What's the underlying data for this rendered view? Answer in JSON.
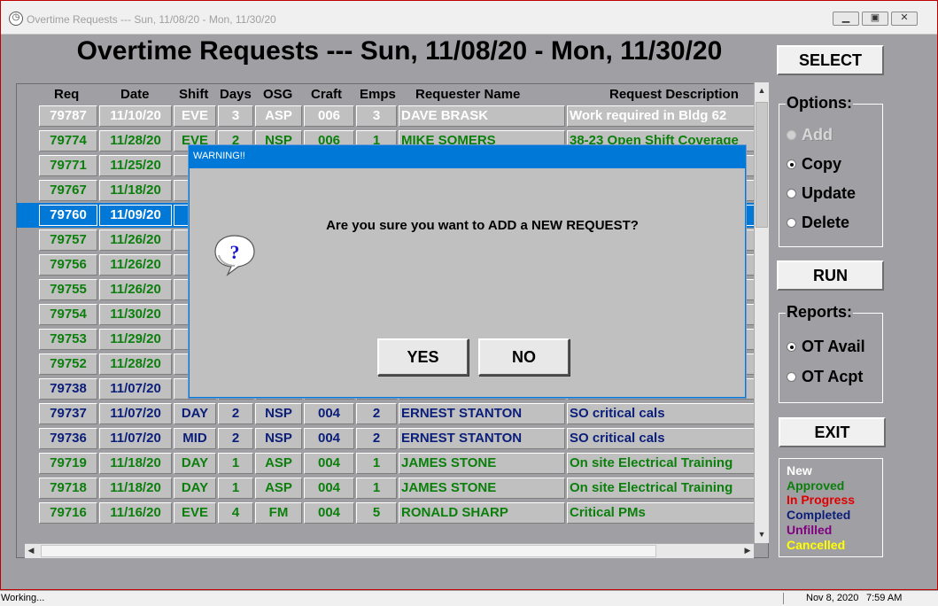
{
  "window": {
    "title": "Overtime Requests --- Sun, 11/08/20 - Mon, 11/30/20",
    "controls": [
      "minimize",
      "restore",
      "close"
    ]
  },
  "main": {
    "title": "Overtime Requests --- Sun, 11/08/20 - Mon, 11/30/20",
    "columns": [
      "Req",
      "Date",
      "Shift",
      "Days",
      "OSG",
      "Craft",
      "Emps",
      "Requester Name",
      "Request Description"
    ],
    "rows": [
      {
        "req": "79787",
        "date": "11/10/20",
        "shift": "EVE",
        "days": "3",
        "osg": "ASP",
        "craft": "006",
        "emps": "3",
        "name": "DAVE BRASK",
        "desc": "Work required in Bldg 62",
        "status": "new"
      },
      {
        "req": "79774",
        "date": "11/28/20",
        "shift": "EVE",
        "days": "2",
        "osg": "NSP",
        "craft": "006",
        "emps": "1",
        "name": "MIKE SOMERS",
        "desc": "38-23 Open Shift Coverage",
        "status": "approved"
      },
      {
        "req": "79771",
        "date": "11/25/20",
        "shift": "E",
        "days": "",
        "osg": "",
        "craft": "",
        "emps": "",
        "name": "",
        "desc": "e",
        "status": "approved"
      },
      {
        "req": "79767",
        "date": "11/18/20",
        "shift": "E",
        "days": "",
        "osg": "",
        "craft": "",
        "emps": "",
        "name": "",
        "desc": "e",
        "status": "approved"
      },
      {
        "req": "79760",
        "date": "11/09/20",
        "shift": "D",
        "days": "",
        "osg": "",
        "craft": "",
        "emps": "",
        "name": "",
        "desc": "",
        "status": "selected"
      },
      {
        "req": "79757",
        "date": "11/26/20",
        "shift": "E",
        "days": "",
        "osg": "",
        "craft": "",
        "emps": "",
        "name": "",
        "desc": "",
        "status": "approved"
      },
      {
        "req": "79756",
        "date": "11/26/20",
        "shift": "D",
        "days": "",
        "osg": "",
        "craft": "",
        "emps": "",
        "name": "",
        "desc": "",
        "status": "approved"
      },
      {
        "req": "79755",
        "date": "11/26/20",
        "shift": "M",
        "days": "",
        "osg": "",
        "craft": "",
        "emps": "",
        "name": "",
        "desc": "",
        "status": "approved"
      },
      {
        "req": "79754",
        "date": "11/30/20",
        "shift": "E",
        "days": "",
        "osg": "",
        "craft": "",
        "emps": "",
        "name": "",
        "desc": "O",
        "status": "approved"
      },
      {
        "req": "79753",
        "date": "11/29/20",
        "shift": "D",
        "days": "",
        "osg": "",
        "craft": "",
        "emps": "",
        "name": "",
        "desc": "O",
        "status": "approved"
      },
      {
        "req": "79752",
        "date": "11/28/20",
        "shift": "M",
        "days": "",
        "osg": "",
        "craft": "",
        "emps": "",
        "name": "",
        "desc": "v",
        "status": "approved"
      },
      {
        "req": "79738",
        "date": "11/07/20",
        "shift": "E",
        "days": "",
        "osg": "",
        "craft": "",
        "emps": "",
        "name": "",
        "desc": "",
        "status": "completed"
      },
      {
        "req": "79737",
        "date": "11/07/20",
        "shift": "DAY",
        "days": "2",
        "osg": "NSP",
        "craft": "004",
        "emps": "2",
        "name": "ERNEST STANTON",
        "desc": "SO critical cals",
        "status": "completed"
      },
      {
        "req": "79736",
        "date": "11/07/20",
        "shift": "MID",
        "days": "2",
        "osg": "NSP",
        "craft": "004",
        "emps": "2",
        "name": "ERNEST STANTON",
        "desc": "SO critical cals",
        "status": "completed"
      },
      {
        "req": "79719",
        "date": "11/18/20",
        "shift": "DAY",
        "days": "1",
        "osg": "ASP",
        "craft": "004",
        "emps": "1",
        "name": "JAMES STONE",
        "desc": "On site Electrical Training",
        "status": "approved"
      },
      {
        "req": "79718",
        "date": "11/18/20",
        "shift": "DAY",
        "days": "1",
        "osg": "ASP",
        "craft": "004",
        "emps": "1",
        "name": "JAMES STONE",
        "desc": "On site Electrical Training",
        "status": "approved"
      },
      {
        "req": "79716",
        "date": "11/16/20",
        "shift": "EVE",
        "days": "4",
        "osg": "FM",
        "craft": "004",
        "emps": "5",
        "name": "RONALD SHARP",
        "desc": "Critical PMs",
        "status": "approved"
      }
    ]
  },
  "panel": {
    "select_label": "SELECT",
    "options_label": "Options:",
    "options": [
      {
        "label": "Add",
        "checked": false,
        "disabled": true
      },
      {
        "label": "Copy",
        "checked": true,
        "disabled": false
      },
      {
        "label": "Update",
        "checked": false,
        "disabled": false
      },
      {
        "label": "Delete",
        "checked": false,
        "disabled": false
      }
    ],
    "run_label": "RUN",
    "reports_label": "Reports:",
    "reports": [
      {
        "label": "OT Avail",
        "checked": true
      },
      {
        "label": "OT Acpt",
        "checked": false
      }
    ],
    "exit_label": "EXIT"
  },
  "legend": [
    {
      "label": "New",
      "color": "#ffffff"
    },
    {
      "label": "Approved",
      "color": "#0b7f0b"
    },
    {
      "label": "In Progress",
      "color": "#e00000"
    },
    {
      "label": "Completed",
      "color": "#0a1e7a"
    },
    {
      "label": "Unfilled",
      "color": "#800080"
    },
    {
      "label": "Cancelled",
      "color": "#ffff00"
    }
  ],
  "statusbar": {
    "left": "Working...",
    "date": "Nov 8, 2020",
    "time": "7:59 AM"
  },
  "dialog": {
    "title": "WARNING!!",
    "message": "Are you sure you want to ADD a NEW REQUEST?",
    "icon": "question-icon",
    "yes_label": "YES",
    "no_label": "NO"
  },
  "colors": {
    "selection": "#0078d7",
    "window_bg": "#a0a0a4"
  }
}
